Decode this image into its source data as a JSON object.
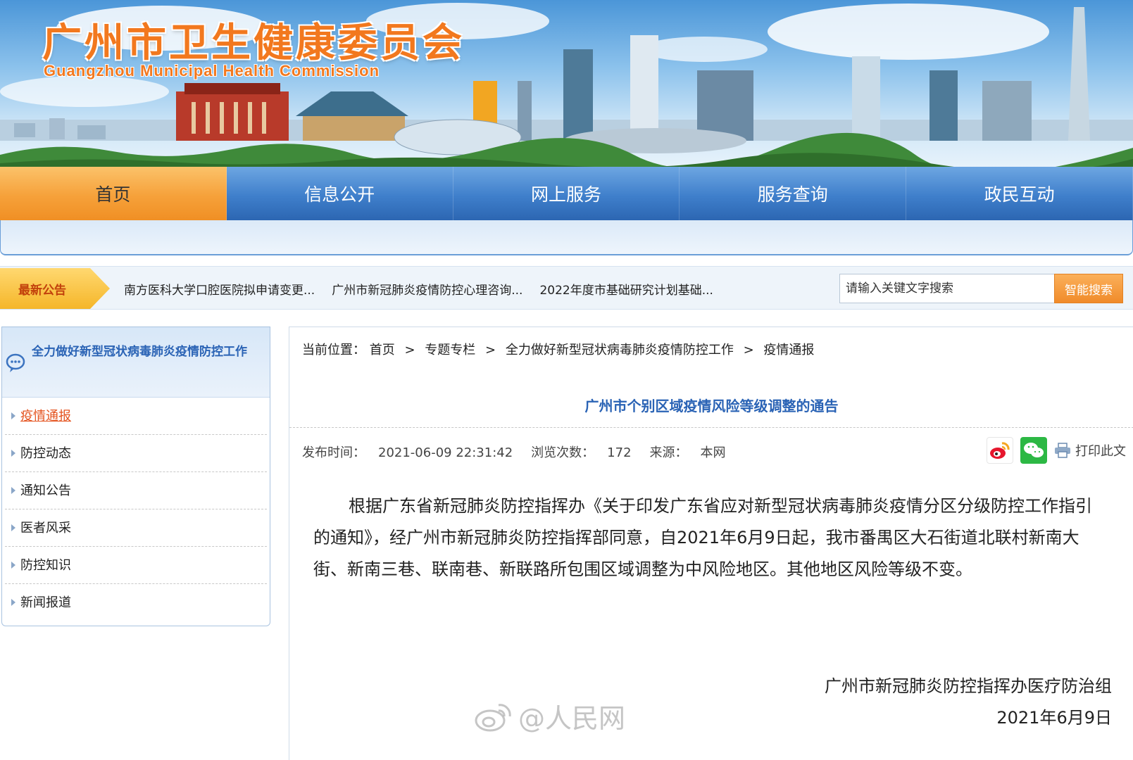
{
  "header": {
    "title": "广州市卫生健康委员会",
    "subtitle": "Guangzhou Municipal Health Commission"
  },
  "nav": {
    "items": [
      {
        "label": "首页",
        "active": true
      },
      {
        "label": "信息公开",
        "active": false
      },
      {
        "label": "网上服务",
        "active": false
      },
      {
        "label": "服务查询",
        "active": false
      },
      {
        "label": "政民互动",
        "active": false
      }
    ]
  },
  "notice": {
    "label": "最新公告",
    "items": [
      "南方医科大学口腔医院拟申请变更...",
      "广州市新冠肺炎疫情防控心理咨询...",
      "2022年度市基础研究计划基础..."
    ]
  },
  "search": {
    "placeholder": "请输入关键文字搜索",
    "button_label": "智能搜索"
  },
  "sidebar": {
    "heading": "全力做好新型冠状病毒肺炎疫情防控工作",
    "items": [
      {
        "label": "疫情通报",
        "active": true
      },
      {
        "label": "防控动态",
        "active": false
      },
      {
        "label": "通知公告",
        "active": false
      },
      {
        "label": "医者风采",
        "active": false
      },
      {
        "label": "防控知识",
        "active": false
      },
      {
        "label": "新闻报道",
        "active": false
      }
    ]
  },
  "breadcrumb": {
    "prefix": "当前位置：",
    "separator": ">",
    "items": [
      "首页",
      "专题专栏",
      "全力做好新型冠状病毒肺炎疫情防控工作",
      "疫情通报"
    ]
  },
  "article": {
    "title": "广州市个别区域疫情风险等级调整的通告",
    "publish_label": "发布时间：",
    "publish_time": "2021-06-09 22:31:42",
    "views_label": "浏览次数：",
    "views": "172",
    "source_label": "来源：",
    "source": "本网",
    "print_label": "打印此文",
    "body": "根据广东省新冠肺炎防控指挥办《关于印发广东省应对新型冠状病毒肺炎疫情分区分级防控工作指引的通知》，经广州市新冠肺炎防控指挥部同意，自2021年6月9日起，我市番禺区大石街道北联村新南大街、新南三巷、联南巷、新联路所包围区域调整为中风险地区。其他地区风险等级不变。",
    "signature_org": "广州市新冠肺炎防控指挥办医疗防治组",
    "signature_date": "2021年6月9日"
  },
  "watermark": "@人民网",
  "colors": {
    "nav_blue": "#3f7fcb",
    "nav_active_orange": "#f6a13a",
    "title_orange": "#f2781e",
    "link_blue": "#2a63b5",
    "active_red": "#e4531f"
  }
}
